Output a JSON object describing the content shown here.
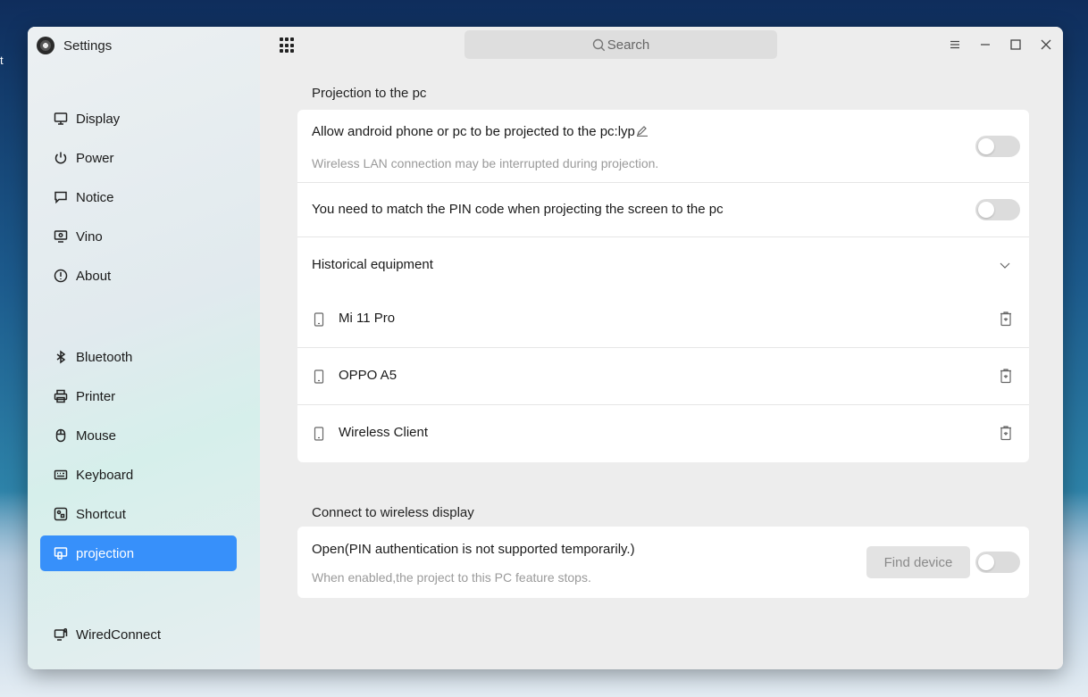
{
  "app": {
    "title": "Settings",
    "icon": "settings-gear-icon"
  },
  "search": {
    "placeholder": "Search"
  },
  "sidebar": {
    "items": [
      {
        "label": "Display",
        "icon": "monitor-icon"
      },
      {
        "label": "Power",
        "icon": "power-icon"
      },
      {
        "label": "Notice",
        "icon": "notice-icon"
      },
      {
        "label": "Vino",
        "icon": "vino-icon"
      },
      {
        "label": "About",
        "icon": "info-icon"
      },
      {
        "label": "Bluetooth",
        "icon": "bluetooth-icon"
      },
      {
        "label": "Printer",
        "icon": "printer-icon"
      },
      {
        "label": "Mouse",
        "icon": "mouse-icon"
      },
      {
        "label": "Keyboard",
        "icon": "keyboard-icon"
      },
      {
        "label": "Shortcut",
        "icon": "shortcut-icon"
      },
      {
        "label": "projection",
        "icon": "projection-icon",
        "active": true
      },
      {
        "label": "WiredConnect",
        "icon": "wired-connect-icon"
      }
    ]
  },
  "projection": {
    "section_title": "Projection to the pc",
    "allow": {
      "label": "Allow android phone or pc to be projected to the pc:lyp",
      "hint": "Wireless LAN connection may be interrupted during projection.",
      "enabled": false
    },
    "pin": {
      "label": "You need to match the PIN code when projecting the screen to the pc",
      "enabled": false
    },
    "history": {
      "label": "Historical equipment",
      "devices": [
        "Mi 11 Pro",
        "OPPO A5",
        "Wireless Client"
      ]
    }
  },
  "wireless": {
    "section_title": "Connect to wireless display",
    "open_label": "Open(PIN authentication is not supported temporarily.)",
    "hint": "When enabled,the project to this PC feature stops.",
    "find_button": "Find device",
    "enabled": false
  },
  "desktop": {
    "edge_text": "t"
  },
  "colors": {
    "accent": "#3790fa",
    "window_bg": "#ededed",
    "card_bg": "#ffffff"
  }
}
